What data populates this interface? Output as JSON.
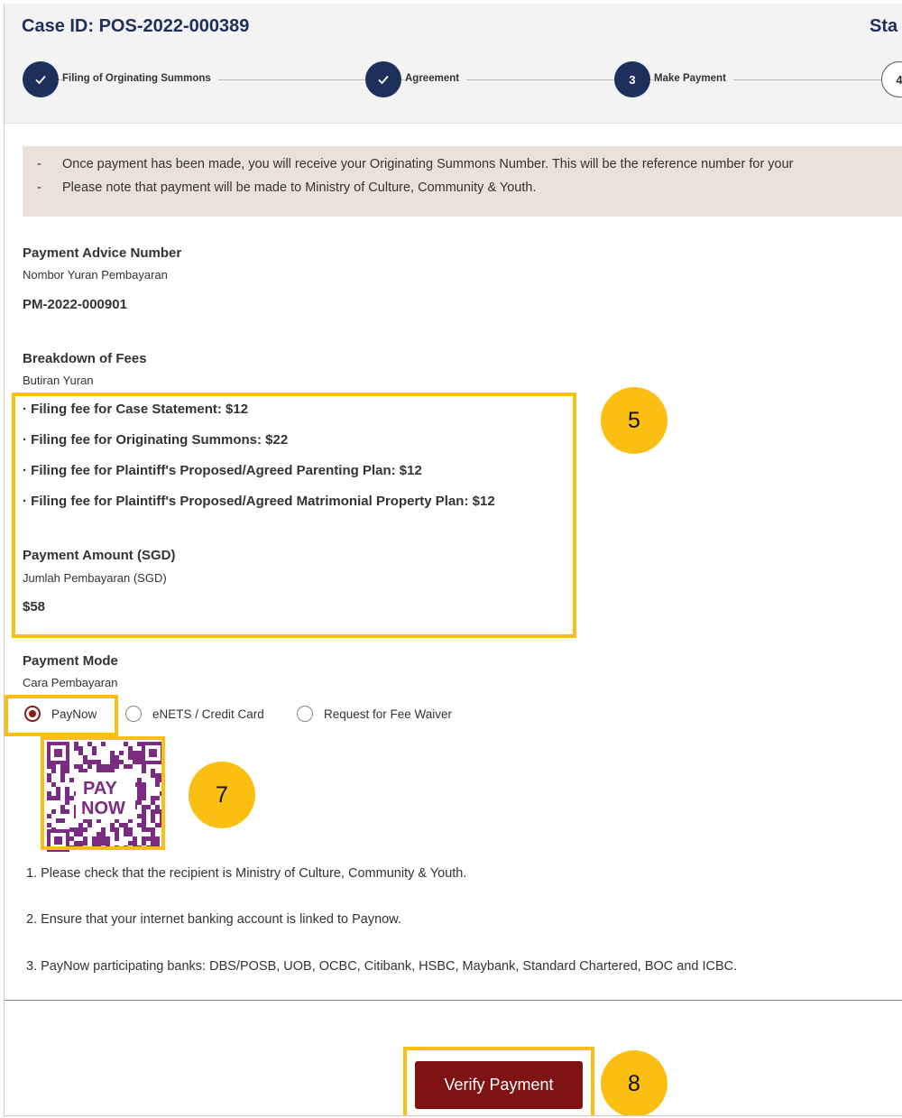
{
  "case": {
    "id": "Case ID: POS-2022-000389",
    "status_label_partial": "Sta"
  },
  "stepper": {
    "steps": [
      {
        "number": "",
        "label": "Filing of Orginating Summons",
        "state": "completed",
        "icon": "checkmark-icon"
      },
      {
        "number": "",
        "label": "Agreement",
        "state": "completed",
        "icon": "checkmark-icon"
      },
      {
        "number": "3",
        "label": "Make Payment",
        "state": "current"
      },
      {
        "number": "4",
        "label": "",
        "state": "upcoming"
      }
    ]
  },
  "notice": {
    "bullet": "-",
    "lines": [
      "Once payment has been made, you will receive your Originating Summons Number. This will be the reference number for your",
      "Please note that payment will be made to Ministry of Culture, Community & Youth."
    ]
  },
  "payment_advice": {
    "label": "Payment Advice Number",
    "label_ms": "Nombor Yuran Pembayaran",
    "value": "PM-2022-000901"
  },
  "fees": {
    "label": "Breakdown of Fees",
    "label_ms": "Butiran Yuran",
    "items": [
      "· Filing fee for Case Statement: $12",
      "· Filing fee for Originating Summons: $22",
      "· Filing fee for Plaintiff's Proposed/Agreed Parenting Plan: $12",
      "· Filing fee for Plaintiff's Proposed/Agreed Matrimonial Property Plan: $12"
    ]
  },
  "payment_amount": {
    "label": "Payment Amount (SGD)",
    "label_ms": "Jumlah Pembayaran (SGD)",
    "value": "$58"
  },
  "payment_mode": {
    "label": "Payment Mode",
    "label_ms": "Cara Pembayaran",
    "options": [
      "PayNow",
      "eNETS / Credit Card",
      "Request for Fee Waiver"
    ],
    "selected": "PayNow"
  },
  "paynow_qr": {
    "logo_line1": "PAY",
    "logo_line2": "NOW"
  },
  "instructions": [
    "1. Please check that the recipient is Ministry of Culture, Community & Youth.",
    "2. Ensure that your internet banking account is linked to Paynow.",
    "3. PayNow participating banks: DBS/POSB, UOB, OCBC, Citibank, HSBC, Maybank, Standard Chartered, BOC and ICBC."
  ],
  "actions": {
    "verify_label": "Verify Payment"
  },
  "callouts": [
    "5",
    "7",
    "8"
  ],
  "colors": {
    "primary_navy": "#1f2f5c",
    "button_maroon": "#7f1212",
    "highlight_yellow": "#fbbf14",
    "notice_bg": "#eae2d8",
    "paynow_purple": "#7b2b82"
  }
}
